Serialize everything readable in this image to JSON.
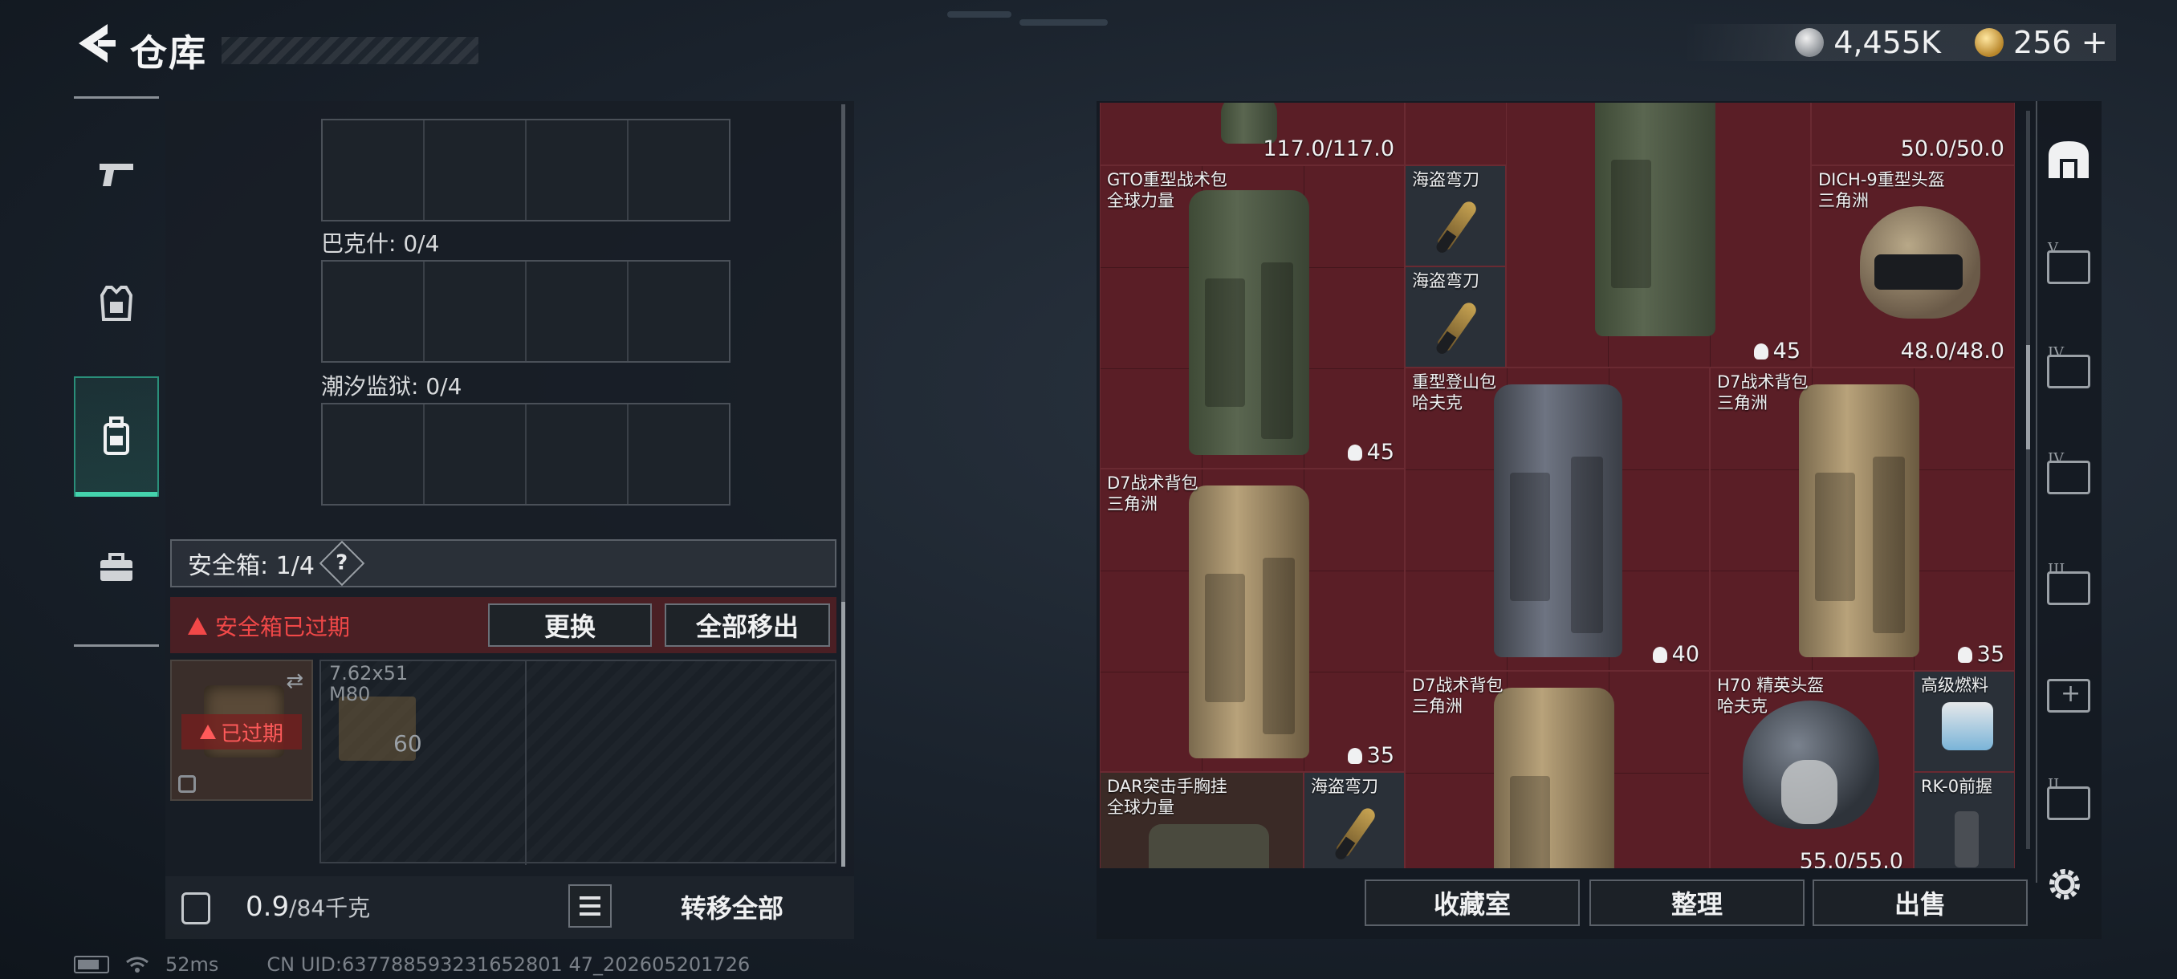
{
  "header": {
    "title": "仓库",
    "currency": [
      {
        "icon": "silver-coin-icon",
        "value": "4,455K"
      },
      {
        "icon": "gold-coin-icon",
        "value": "256"
      }
    ],
    "add_label": "+"
  },
  "left_nav": {
    "items": [
      {
        "name": "weapon",
        "icon": "pistol-icon"
      },
      {
        "name": "armor",
        "icon": "vest-icon"
      },
      {
        "name": "backpack",
        "icon": "backpack-icon",
        "active": true
      },
      {
        "name": "toolbox",
        "icon": "toolbox-icon"
      }
    ]
  },
  "loadout": {
    "rows": [
      {
        "label": "巴克什: 0/4"
      },
      {
        "label": "潮汐监狱: 0/4"
      }
    ],
    "safe_box_label": "安全箱: 1/4",
    "help_label": "?",
    "warning": "安全箱已过期",
    "replace_button": "更换",
    "move_all_button": "全部移出",
    "container_expired": "已过期",
    "ammo": {
      "label_line1": "7.62x51",
      "label_line2": "M80",
      "count": "60"
    },
    "weight_value": "0.9",
    "weight_unit": "/84千克",
    "transfer_all_button": "转移全部"
  },
  "stash": {
    "items": [
      {
        "id": "top-left-durability",
        "value": "117.0/117.0"
      },
      {
        "id": "top-right-durability",
        "value": "50.0/50.0"
      },
      {
        "id": "gto-backpack",
        "name": "GTO重型战术包",
        "sub": "全球力量",
        "value": "45"
      },
      {
        "id": "knife-1",
        "name": "海盗弯刀"
      },
      {
        "id": "knife-2",
        "name": "海盗弯刀"
      },
      {
        "id": "mid-backpack",
        "value": "45"
      },
      {
        "id": "dich-helmet",
        "name": "DICH-9重型头盔",
        "sub": "三角洲",
        "value": "48.0/48.0"
      },
      {
        "id": "heavy-climb",
        "name": "重型登山包",
        "sub": "哈夫克",
        "value": "40"
      },
      {
        "id": "d7-right",
        "name": "D7战术背包",
        "sub": "三角洲",
        "value": "35"
      },
      {
        "id": "d7-left",
        "name": "D7战术背包",
        "sub": "三角洲",
        "value": "35"
      },
      {
        "id": "d7-bottom",
        "name": "D7战术背包",
        "sub": "三角洲"
      },
      {
        "id": "h70-helmet",
        "name": "H70 精英头盔",
        "sub": "哈夫克",
        "value": "55.0/55.0"
      },
      {
        "id": "fuel",
        "name": "高级燃料"
      },
      {
        "id": "dar-rig",
        "name": "DAR突击手胸挂",
        "sub": "全球力量"
      },
      {
        "id": "knife-3",
        "name": "海盗弯刀"
      },
      {
        "id": "rk0-grip",
        "name": "RK-0前握"
      }
    ]
  },
  "right_nav": {
    "items": [
      {
        "icon": "home-icon"
      },
      {
        "icon": "stash-tier-5-icon",
        "roman": "V"
      },
      {
        "icon": "stash-tier-4a-icon",
        "roman": "IV"
      },
      {
        "icon": "stash-tier-4b-icon",
        "roman": "IV"
      },
      {
        "icon": "stash-tier-3-icon",
        "roman": "III"
      },
      {
        "icon": "stash-add-icon",
        "roman": ""
      },
      {
        "icon": "stash-tier-2-icon",
        "roman": "II"
      }
    ]
  },
  "bottom_buttons": {
    "collection": "收藏室",
    "organize": "整理",
    "sell": "出售"
  },
  "status_bar": {
    "ping": "52ms",
    "uid": "CN UID:637788593231652801 47_202605201726"
  }
}
